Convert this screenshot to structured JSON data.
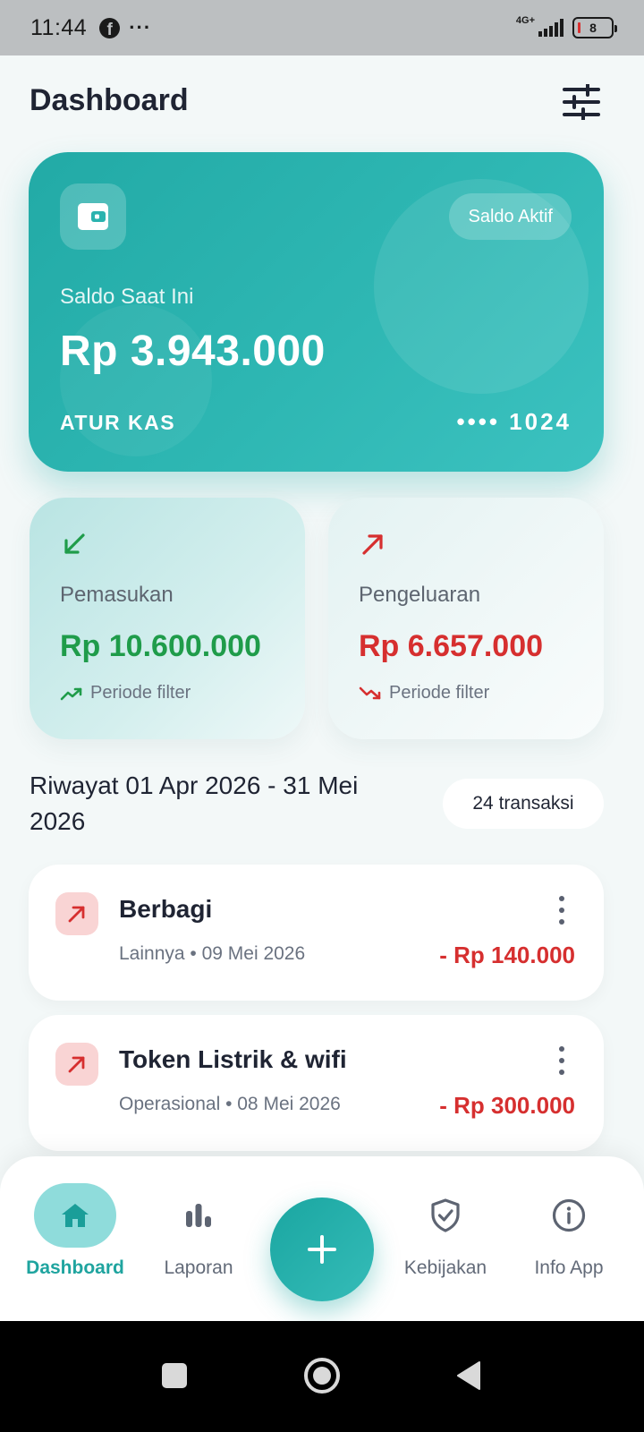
{
  "status_bar": {
    "time": "11:44",
    "network": "4G+",
    "battery": "8"
  },
  "header": {
    "title": "Dashboard"
  },
  "balance_card": {
    "chip_label": "Saldo Aktif",
    "label": "Saldo Saat Ini",
    "amount": "Rp 3.943.000",
    "owner": "ATUR KAS",
    "card_number": "•••• 1024"
  },
  "summary": {
    "income": {
      "label": "Pemasukan",
      "amount": "Rp 10.600.000",
      "period": "Periode filter"
    },
    "expense": {
      "label": "Pengeluaran",
      "amount": "Rp 6.657.000",
      "period": "Periode filter"
    }
  },
  "history": {
    "title": "Riwayat 01 Apr 2026 - 31 Mei 2026",
    "count": "24 transaksi",
    "transactions": [
      {
        "title": "Berbagi",
        "meta": "Lainnya • 09 Mei 2026",
        "amount": "- Rp 140.000"
      },
      {
        "title": "Token Listrik & wifi",
        "meta": "Operasional • 08 Mei 2026",
        "amount": "- Rp 300.000"
      }
    ]
  },
  "nav": {
    "items": [
      {
        "label": "Dashboard",
        "icon": "home-icon"
      },
      {
        "label": "Laporan",
        "icon": "bar-chart-icon"
      },
      {
        "label": "Kebijakan",
        "icon": "shield-check-icon"
      },
      {
        "label": "Info App",
        "icon": "info-icon"
      }
    ],
    "fab_icon": "plus-icon"
  },
  "colors": {
    "accent": "#22aaa6",
    "income": "#1f9c4a",
    "expense": "#d62f2f",
    "background": "#f3f8f8"
  }
}
